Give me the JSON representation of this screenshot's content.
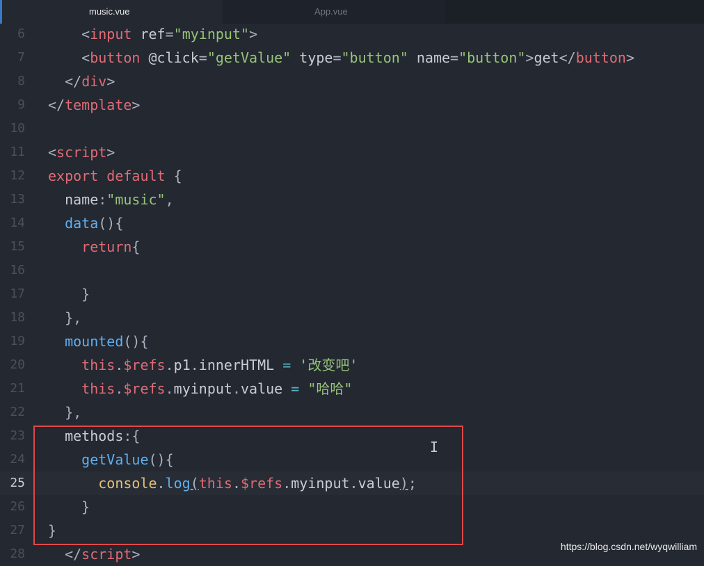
{
  "tabs": [
    {
      "label": "music.vue",
      "active": true
    },
    {
      "label": "App.vue",
      "active": false
    }
  ],
  "lines": [
    {
      "n": "6",
      "segs": [
        [
          "a",
          "    "
        ],
        [
          "p",
          "<"
        ],
        [
          "t",
          "input"
        ],
        [
          "a",
          " ref"
        ],
        [
          "p",
          "="
        ],
        [
          "s",
          "\"myinput\""
        ],
        [
          "p",
          ">"
        ]
      ]
    },
    {
      "n": "7",
      "segs": [
        [
          "a",
          "    "
        ],
        [
          "p",
          "<"
        ],
        [
          "t",
          "button"
        ],
        [
          "a",
          " @click"
        ],
        [
          "p",
          "="
        ],
        [
          "s",
          "\"getValue\""
        ],
        [
          "a",
          " type"
        ],
        [
          "p",
          "="
        ],
        [
          "s",
          "\"button\""
        ],
        [
          "a",
          " name"
        ],
        [
          "p",
          "="
        ],
        [
          "s",
          "\"button\""
        ],
        [
          "p",
          ">"
        ],
        [
          "a",
          "get"
        ],
        [
          "p",
          "</"
        ],
        [
          "t",
          "button"
        ],
        [
          "p",
          ">"
        ]
      ]
    },
    {
      "n": "8",
      "segs": [
        [
          "a",
          "  "
        ],
        [
          "p",
          "</"
        ],
        [
          "t",
          "div"
        ],
        [
          "p",
          ">"
        ]
      ]
    },
    {
      "n": "9",
      "segs": [
        [
          "p",
          "</"
        ],
        [
          "t",
          "template"
        ],
        [
          "p",
          ">"
        ]
      ]
    },
    {
      "n": "10",
      "segs": []
    },
    {
      "n": "11",
      "segs": [
        [
          "p",
          "<"
        ],
        [
          "t",
          "script"
        ],
        [
          "p",
          ">"
        ]
      ]
    },
    {
      "n": "12",
      "segs": [
        [
          "k",
          "export"
        ],
        [
          "a",
          " "
        ],
        [
          "k",
          "default"
        ],
        [
          "p",
          " {"
        ]
      ]
    },
    {
      "n": "13",
      "segs": [
        [
          "a",
          "  name"
        ],
        [
          "p",
          ":"
        ],
        [
          "s",
          "\"music\""
        ],
        [
          "p",
          ","
        ]
      ]
    },
    {
      "n": "14",
      "segs": [
        [
          "a",
          "  "
        ],
        [
          "f",
          "data"
        ],
        [
          "p",
          "(){"
        ]
      ]
    },
    {
      "n": "15",
      "segs": [
        [
          "a",
          "    "
        ],
        [
          "k",
          "return"
        ],
        [
          "p",
          "{"
        ]
      ]
    },
    {
      "n": "16",
      "segs": []
    },
    {
      "n": "17",
      "segs": [
        [
          "p",
          "    }"
        ]
      ]
    },
    {
      "n": "18",
      "segs": [
        [
          "p",
          "  },"
        ]
      ]
    },
    {
      "n": "19",
      "segs": [
        [
          "a",
          "  "
        ],
        [
          "f",
          "mounted"
        ],
        [
          "p",
          "(){"
        ]
      ]
    },
    {
      "n": "20",
      "segs": [
        [
          "a",
          "    "
        ],
        [
          "k",
          "this"
        ],
        [
          "p",
          "."
        ],
        [
          "t",
          "$refs"
        ],
        [
          "p",
          "."
        ],
        [
          "a",
          "p1"
        ],
        [
          "p",
          "."
        ],
        [
          "a",
          "innerHTML"
        ],
        [
          "o",
          " = "
        ],
        [
          "s",
          "'改变吧'"
        ]
      ]
    },
    {
      "n": "21",
      "segs": [
        [
          "a",
          "    "
        ],
        [
          "k",
          "this"
        ],
        [
          "p",
          "."
        ],
        [
          "t",
          "$refs"
        ],
        [
          "p",
          "."
        ],
        [
          "a",
          "myinput"
        ],
        [
          "p",
          "."
        ],
        [
          "a",
          "value"
        ],
        [
          "o",
          " = "
        ],
        [
          "s",
          "\"哈哈\""
        ]
      ]
    },
    {
      "n": "22",
      "segs": [
        [
          "p",
          "  },"
        ]
      ]
    },
    {
      "n": "23",
      "segs": [
        [
          "a",
          "  methods"
        ],
        [
          "p",
          ":{"
        ]
      ]
    },
    {
      "n": "24",
      "segs": [
        [
          "a",
          "    "
        ],
        [
          "f",
          "getValue"
        ],
        [
          "p",
          "(){"
        ]
      ]
    },
    {
      "n": "25",
      "segs": [
        [
          "a",
          "      "
        ],
        [
          "m",
          "console"
        ],
        [
          "p",
          "."
        ],
        [
          "f",
          "log"
        ],
        [
          "pu",
          "("
        ],
        [
          "k",
          "this"
        ],
        [
          "p",
          "."
        ],
        [
          "t",
          "$refs"
        ],
        [
          "p",
          "."
        ],
        [
          "a",
          "myinput"
        ],
        [
          "p",
          "."
        ],
        [
          "a",
          "value"
        ],
        [
          "pu",
          ")"
        ],
        [
          "p",
          ";"
        ]
      ]
    },
    {
      "n": "26",
      "segs": [
        [
          "p",
          "    }"
        ]
      ]
    },
    {
      "n": "27",
      "segs": [
        [
          "p",
          "}"
        ]
      ]
    },
    {
      "n": "28",
      "segs": [
        [
          "p",
          "  </"
        ],
        [
          "t",
          "script"
        ],
        [
          "p",
          ">"
        ]
      ]
    }
  ],
  "current_line": "25",
  "watermark": "https://blog.csdn.net/wyqwilliam",
  "colors": {
    "background": "#232831",
    "highlight_border": "#e04848"
  }
}
